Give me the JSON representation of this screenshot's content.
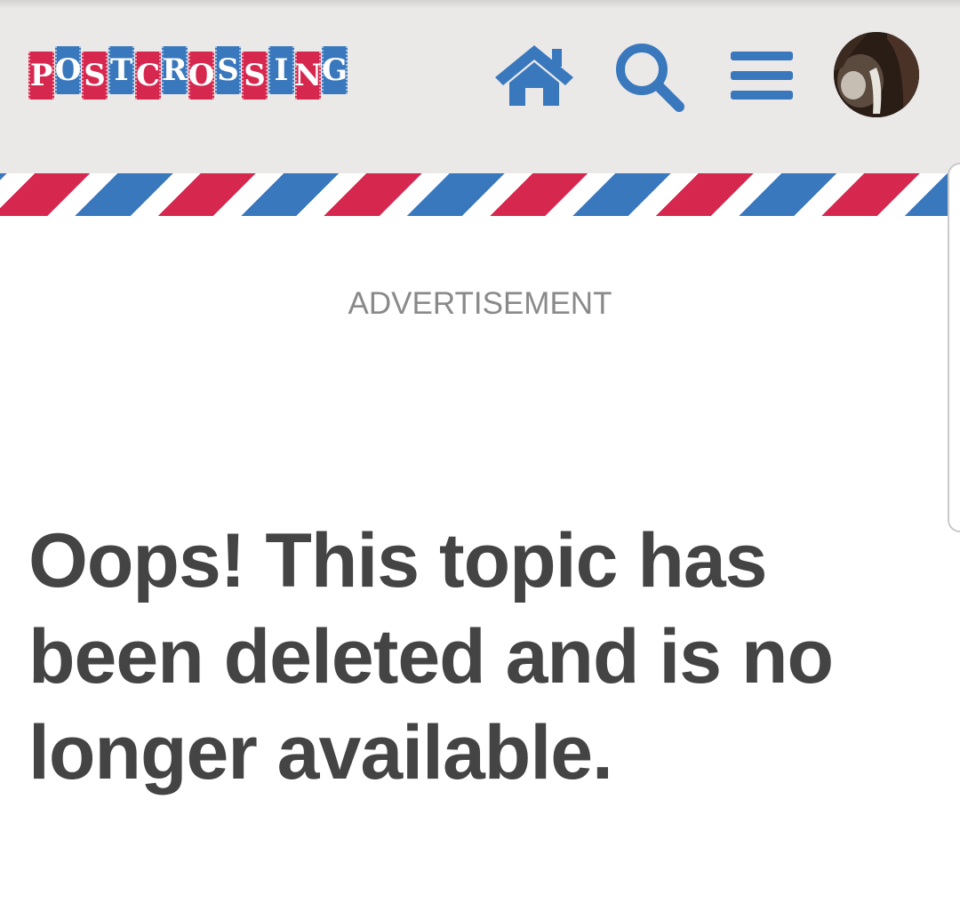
{
  "header": {
    "logo_letters": [
      "P",
      "O",
      "S",
      "T",
      "C",
      "R",
      "O",
      "S",
      "S",
      "I",
      "N",
      "G"
    ],
    "home_icon": "home-icon",
    "search_icon": "search-icon",
    "menu_icon": "hamburger-menu-icon",
    "avatar": "user-avatar"
  },
  "colors": {
    "brand_red": "#d6284f",
    "brand_blue": "#3a78bd",
    "header_bg": "#ebe9e8",
    "text_dark": "#444444",
    "text_muted": "#8a8a8a"
  },
  "main": {
    "ad_label": "ADVERTISEMENT",
    "message": "Oops! This topic has been deleted and is no longer available."
  }
}
